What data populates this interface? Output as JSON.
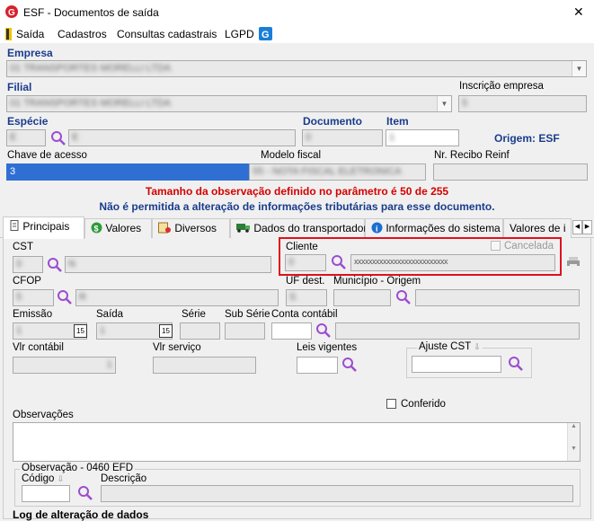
{
  "window": {
    "title": "ESF - Documentos de saída",
    "close": "✕"
  },
  "menu": {
    "saida": "Saída",
    "cadastros": "Cadastros",
    "consultas": "Consultas cadastrais",
    "lgpd": "LGPD"
  },
  "empresa": {
    "label": "Empresa",
    "value": "01 TRANSPORTES MORELLI LTDA"
  },
  "filial": {
    "label": "Filial",
    "value": "01 TRANSPORTES MORELLI LTDA"
  },
  "inscricao": {
    "label": "Inscrição empresa",
    "value": "5"
  },
  "especie": {
    "label": "Espécie",
    "code": "E",
    "desc": "E"
  },
  "documento": {
    "label": "Documento",
    "value": "0"
  },
  "item": {
    "label": "Item",
    "value": "1"
  },
  "origem": {
    "text": "Origem: ESF"
  },
  "chave": {
    "label": "Chave de acesso",
    "value": "3"
  },
  "modelo": {
    "label": "Modelo fiscal",
    "value": "55 - NOTA FISCAL ELETRONICA"
  },
  "recibo": {
    "label": "Nr. Recibo Reinf",
    "value": ""
  },
  "warnings": {
    "line1": "Tamanho da observação definido no parâmetro é 50 de 255",
    "line2": "Não é permitida a alteração de informações tributárias para esse documento."
  },
  "tabs": [
    {
      "label": "Principais"
    },
    {
      "label": "Valores"
    },
    {
      "label": "Diversos"
    },
    {
      "label": "Dados do transportador"
    },
    {
      "label": "Informações do sistema"
    },
    {
      "label": "Valores de i"
    }
  ],
  "cst": {
    "label": "CST",
    "code": "0",
    "desc": "N"
  },
  "cliente": {
    "label": "Cliente",
    "code": "0",
    "desc": "xxxxxxxxxxxxxxxxxxxxxxxxxx",
    "cancelada": "Cancelada"
  },
  "cfop": {
    "label": "CFOP",
    "code": "5",
    "desc": "R"
  },
  "uf": {
    "label": "UF dest.",
    "value": "S"
  },
  "municipio": {
    "label": "Município - Origem",
    "value": ""
  },
  "emissao": {
    "label": "Emissão",
    "value": "1"
  },
  "saida": {
    "label": "Saída",
    "value": "1"
  },
  "serie": {
    "label": "Série",
    "value": ""
  },
  "subserie": {
    "label": "Sub Série",
    "value": ""
  },
  "conta": {
    "label": "Conta contábil",
    "value": ""
  },
  "vlr_contabil": {
    "label": "Vlr contábil",
    "value": "1"
  },
  "vlr_servico": {
    "label": "Vlr serviço",
    "value": ""
  },
  "leis": {
    "label": "Leis vigentes",
    "value": ""
  },
  "ajuste": {
    "label": "Ajuste CST",
    "value": ""
  },
  "conferido": {
    "label": "Conferido"
  },
  "observacoes": {
    "label": "Observações",
    "value": ""
  },
  "obs0460": {
    "group": "Observação - 0460 EFD",
    "codigo_label": "Código",
    "descricao_label": "Descrição"
  },
  "log": {
    "label": "Log de alteração de dados"
  },
  "colors": {
    "highlight": "#e0101c",
    "accent_label": "#1a3c8c",
    "warning": "#d40000",
    "selected_field": "#2f6fd4"
  }
}
